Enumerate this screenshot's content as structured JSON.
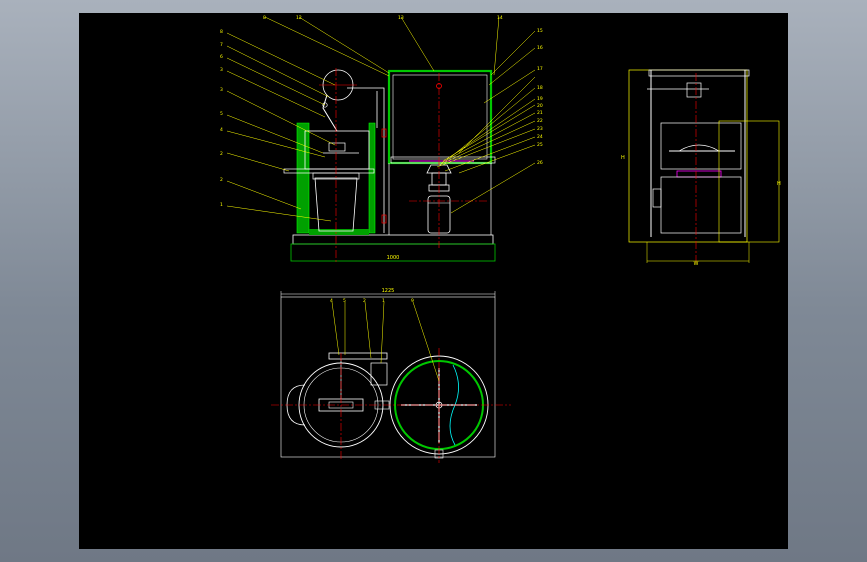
{
  "colors": {
    "background": "#000000",
    "outline": "#ffffff",
    "leader": "#ffff00",
    "centerline": "#ff0000",
    "section": "#00c800",
    "magenta": "#ff00ff",
    "cyan": "#00ffff"
  },
  "front_view": {
    "callouts_left": [
      "8",
      "7",
      "6",
      "3",
      "5",
      "4",
      "2",
      "2",
      "1"
    ],
    "callouts_top": [
      "8",
      "12",
      "13",
      "14"
    ],
    "callouts_right": [
      "15",
      "16",
      "17",
      "18",
      "19",
      "20",
      "21",
      "22",
      "23",
      "24",
      "25",
      "26"
    ],
    "base_dimension": "1000"
  },
  "side_view": {
    "height_dimension": "H",
    "right_dimension": "H",
    "bottom_dimension": "W"
  },
  "top_view": {
    "overall_dimension": "1225",
    "callouts": [
      "4",
      "5",
      "2",
      "1",
      "9"
    ]
  }
}
